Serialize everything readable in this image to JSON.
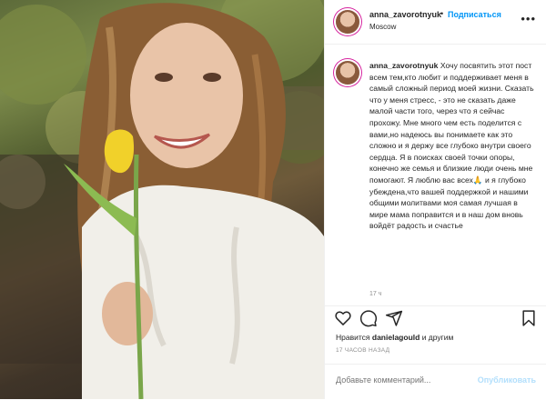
{
  "post": {
    "username": "anna_zavorotnyuk",
    "follow_label": "Подписаться",
    "location": "Moscow"
  },
  "caption": {
    "username": "anna_zavorotnyuk",
    "text": "Хочу посвятить этот пост всем тем,кто любит и поддерживает меня в самый сложный период моей жизни. Сказать что у меня стресс, - это не сказать даже малой части того, через что я сейчас прохожу. Мне много чем есть поделится с вами,но надеюсь вы понимаете как это сложно и я держу все глубоко внутри своего сердца. Я в поисках своей точки опоры, конечно же семья и близкие люди очень мне помогают. Я люблю вас всех🙏 и я глубоко убеждена,что вашей поддержкой и нашими общими молитвами моя самая лучшая в мире мама поправится и в наш дом вновь войдёт радость и счастье",
    "time": "17 ч"
  },
  "actions": {
    "icons": [
      "heart-icon",
      "comment-icon",
      "share-icon",
      "bookmark-icon"
    ]
  },
  "likes": {
    "prefix": "Нравится",
    "user": "danielagould",
    "suffix": "и другим"
  },
  "timestamp": "17 ЧАСОВ НАЗАД",
  "comment": {
    "placeholder": "Добавьте комментарий...",
    "publish_label": "Опубликовать"
  },
  "colors": {
    "accent": "#0095f6",
    "publish_disabled": "#b2dffc",
    "text": "#262626",
    "muted": "#8e8e8e"
  }
}
